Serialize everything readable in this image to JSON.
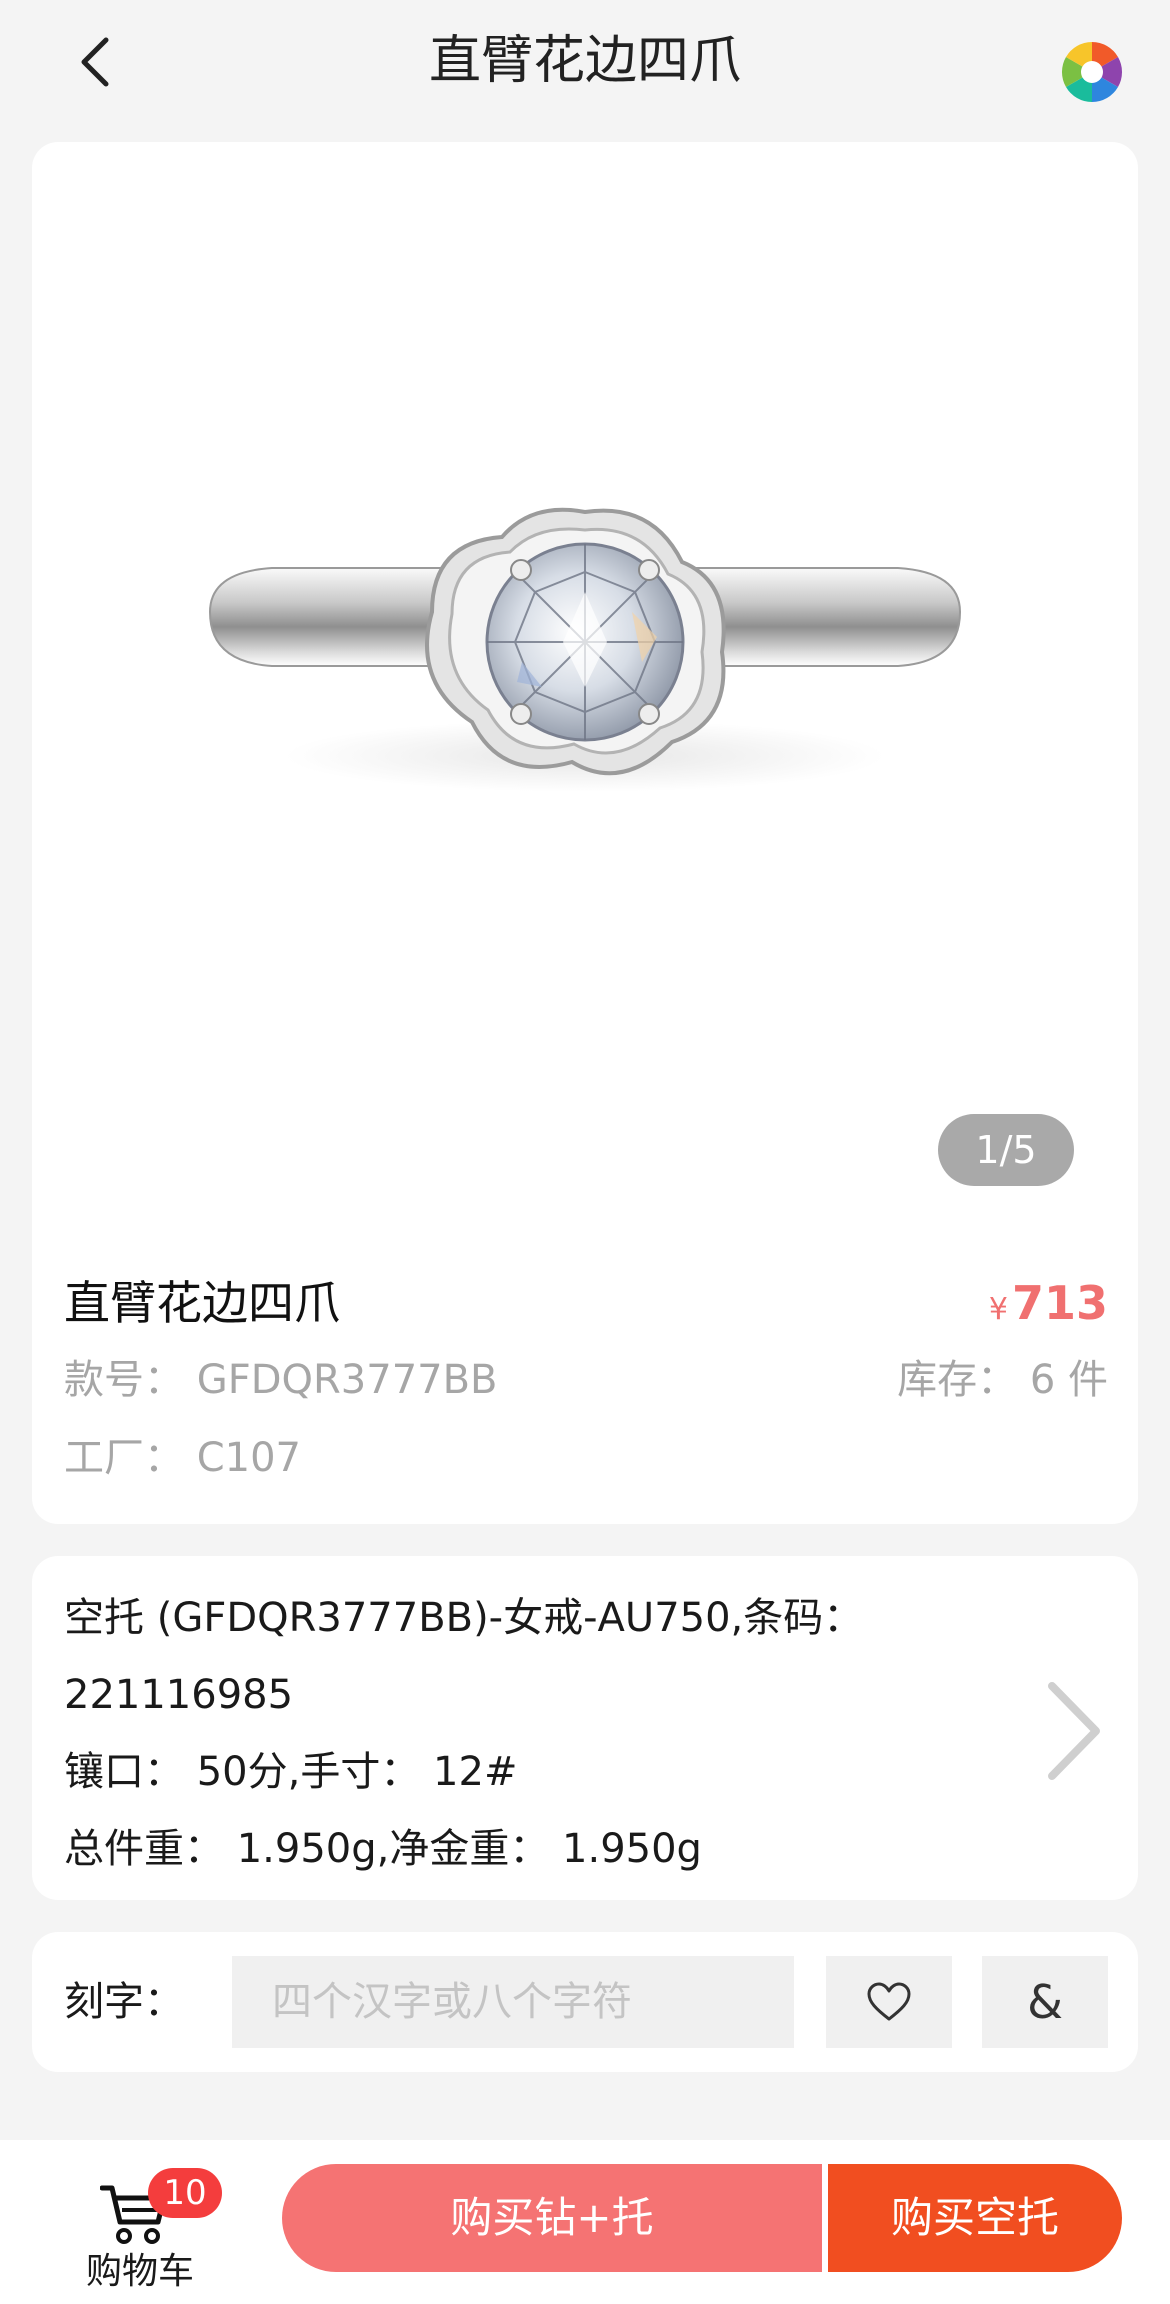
{
  "header": {
    "title": "直臂花边四爪"
  },
  "gallery": {
    "indicator": "1/5"
  },
  "product": {
    "name": "直臂花边四爪",
    "price_currency": "¥",
    "price_value": "713",
    "style_no": "款号：  GFDQR3777BB",
    "stock": "库存：  6 件",
    "factory": "工厂：  C107"
  },
  "spec": {
    "line1": "空托 (GFDQR3777BB)-女戒-AU750,条码：",
    "line2": "221116985",
    "line3": "镶口：  50分,手寸：  12#",
    "line4": "总件重：  1.950g,净金重：  1.950g"
  },
  "engrave": {
    "label": "刻字：",
    "placeholder": "四个汉字或八个字符",
    "symbol_heart": "heart-icon",
    "symbol_amp": "&"
  },
  "bottom": {
    "cart_count": "10",
    "cart_label": "购物车",
    "buy_combo": "购买钻+托",
    "buy_empty": "购买空托"
  },
  "colors": {
    "price": "#f07070",
    "buy_combo_bg": "#f57373",
    "buy_empty_bg": "#f14e20",
    "badge": "#f43d3d"
  }
}
